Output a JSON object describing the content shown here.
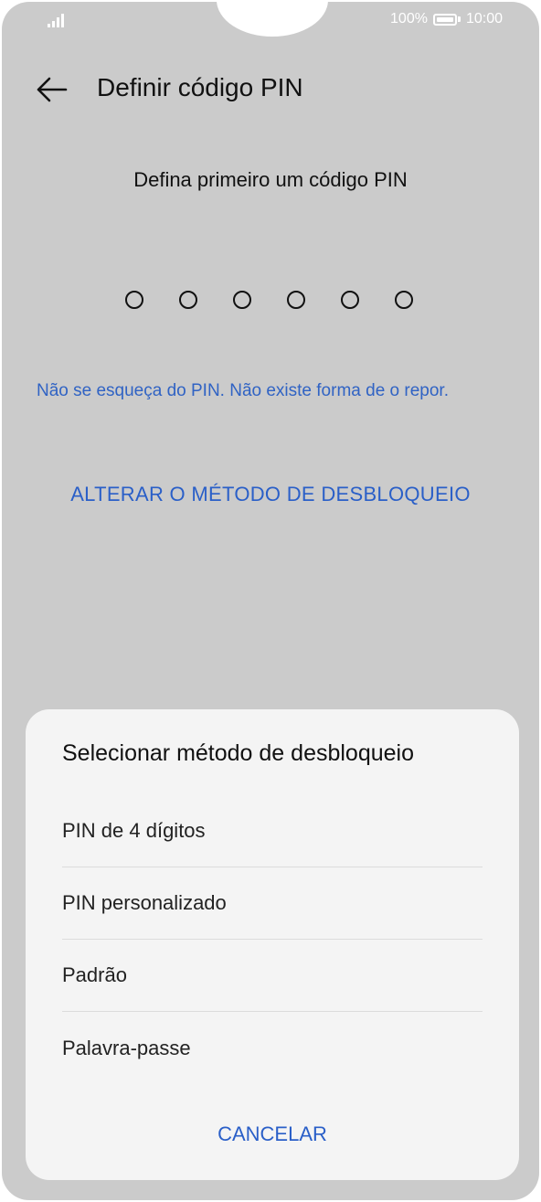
{
  "status_bar": {
    "battery_percent": "100%",
    "time": "10:00",
    "battery_level": 1.0
  },
  "header": {
    "title": "Definir código PIN",
    "back_icon": "arrow-left-icon"
  },
  "main": {
    "instruction": "Defina primeiro um código PIN",
    "pin_length": 6,
    "warning": "Não se esqueça do PIN. Não existe forma de o repor.",
    "change_method_label": "ALTERAR O MÉTODO DE DESBLOQUEIO"
  },
  "sheet": {
    "title": "Selecionar método de desbloqueio",
    "options": [
      {
        "label": "PIN de 4 dígitos"
      },
      {
        "label": "PIN personalizado"
      },
      {
        "label": "Padrão"
      },
      {
        "label": "Palavra-passe"
      }
    ],
    "cancel_label": "CANCELAR"
  },
  "colors": {
    "background": "#cbcbcb",
    "accent": "#2a5fc8",
    "sheet": "#f4f4f4"
  }
}
